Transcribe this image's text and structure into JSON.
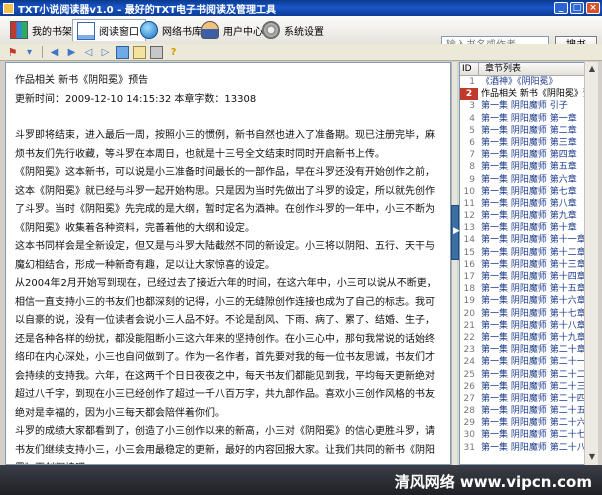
{
  "window": {
    "title": "TXT小说阅读器v1.0 - 最好的TXT电子书阅读及管理工具",
    "minimize": "_",
    "maximize": "□",
    "close": "×"
  },
  "nav": {
    "items": [
      {
        "label": "我的书架",
        "icon": "bookshelf-icon"
      },
      {
        "label": "阅读窗口",
        "icon": "reading-window-icon"
      },
      {
        "label": "网络书库",
        "icon": "globe-icon"
      },
      {
        "label": "用户中心",
        "icon": "user-icon"
      },
      {
        "label": "系统设置",
        "icon": "gear-icon"
      }
    ],
    "active": "阅读窗口"
  },
  "search": {
    "placeholder": "输入书名或作者",
    "button_label": "搜书"
  },
  "toolbar": {
    "icons": [
      "flag-icon",
      "dropdown-icon",
      "back-icon",
      "forward-icon",
      "prev-page-icon",
      "next-page-icon",
      "bookmark-icon",
      "view-icon",
      "settings-icon",
      "help-icon"
    ]
  },
  "document": {
    "title": "作品相关 新书《阴阳冕》预告",
    "meta": "更新时间：2009-12-10 14:15:32  本章字数：13308",
    "paragraphs": [
      "斗罗即将结束，进入最后一周，按照小三的惯例，新书自然也进入了准备期。现已注册完毕，麻烦书友们先行收藏，等斗罗在本周日，也就是十三号全文结束时同时开启新书上传。",
      "《阴阳冕》这本新书，可以说是小三准备时间最长的一部作品，早在斗罗还没有开始创作之前，这本《阴阳冕》就已经与斗罗一起开始构思。只是因为当时先做出了斗罗的设定，所以就先创作了斗罗。当时《阴阳冕》先完成的是大纲，暂时定名为酒神。在创作斗罗的一年中，小三不断为《阴阳冕》收集着各种资料，完善着他的大纲和设定。",
      "这本书同样会是全新设定，但又是与斗罗大陆截然不同的新设定。小三将以阴阳、五行、天干与魔幻相结合，形成一种新奇有趣，足以让大家惊喜的设定。",
      "从2004年2月开始写到现在，已经过去了接近六年的时间，在这六年中，小三可以说从不断更，相信一直支持小三的书友们也都深刻的记得，小三的无缝隙创作连接也成为了自己的标志。我可以自豪的说，没有一位读者会说小三人品不好。不论是刮风、下雨、病了、累了、结婚、生子，还是各种各样的纷扰，都没能阻断小三这六年来的坚持创作。在小三心中，那句我常说的话始终络印在内心深处，小三也自问做到了。作为一名作者，首先要对我的每一位书友思诚，书友们才会持续的支持我。六年，在这两千个日日夜夜之中，每天书友们都能见到我，平均每天更新绝对超过八千字，到现在小三已经创作了超过一千八百万字，共九部作品。喜欢小三创作风格的书友绝对是幸福的，因为小三每天都会陪伴着你们。",
      "斗罗的成绩大家都看到了，创造了小三创作以来的新高，小三对《阴阳冕》的信心更胜斗罗，请书友们继续支持小三，小三会用最稳定的更新，最好的内容回报大家。让我们共同的新书《阴阳冕》再创辉煌吧。"
    ]
  },
  "chapters": {
    "col_id": "ID",
    "col_title": "章节列表",
    "items": [
      {
        "id": "1",
        "title": "《酒神》《阴阳冕》"
      },
      {
        "id": "2",
        "title": "作品相关 新书《阴阳冕》预告"
      },
      {
        "id": "3",
        "title": "第一集 阴阳魔师 引子"
      },
      {
        "id": "4",
        "title": "第一集 阴阳魔师 第一章"
      },
      {
        "id": "5",
        "title": "第一集 阴阳魔师 第二章"
      },
      {
        "id": "6",
        "title": "第一集 阴阳魔师 第三章"
      },
      {
        "id": "7",
        "title": "第一集 阴阳魔师 第四章"
      },
      {
        "id": "8",
        "title": "第一集 阴阳魔师 第五章"
      },
      {
        "id": "9",
        "title": "第一集 阴阳魔师 第六章"
      },
      {
        "id": "10",
        "title": "第一集 阴阳魔师 第七章"
      },
      {
        "id": "11",
        "title": "第一集 阴阳魔师 第八章"
      },
      {
        "id": "12",
        "title": "第一集 阴阳魔师 第九章"
      },
      {
        "id": "13",
        "title": "第一集 阴阳魔师 第十章"
      },
      {
        "id": "14",
        "title": "第一集 阴阳魔师 第十一章"
      },
      {
        "id": "15",
        "title": "第一集 阴阳魔师 第十二章"
      },
      {
        "id": "16",
        "title": "第一集 阴阳魔师 第十三章"
      },
      {
        "id": "17",
        "title": "第一集 阴阳魔师 第十四章"
      },
      {
        "id": "18",
        "title": "第一集 阴阳魔师 第十五章"
      },
      {
        "id": "19",
        "title": "第一集 阴阳魔师 第十六章"
      },
      {
        "id": "20",
        "title": "第一集 阴阳魔师 第十七章"
      },
      {
        "id": "21",
        "title": "第一集 阴阳魔师 第十八章"
      },
      {
        "id": "22",
        "title": "第一集 阴阳魔师 第十九章"
      },
      {
        "id": "23",
        "title": "第一集 阴阳魔师 第二十章"
      },
      {
        "id": "24",
        "title": "第一集 阴阳魔师 第二十一章"
      },
      {
        "id": "25",
        "title": "第一集 阴阳魔师 第二十二章"
      },
      {
        "id": "26",
        "title": "第一集 阴阳魔师 第二十三章"
      },
      {
        "id": "27",
        "title": "第一集 阴阳魔师 第二十四章"
      },
      {
        "id": "28",
        "title": "第一集 阴阳魔师 第二十五章"
      },
      {
        "id": "29",
        "title": "第一集 阴阳魔师 第二十六章"
      },
      {
        "id": "30",
        "title": "第一集 阴阳魔师 第二十七章"
      },
      {
        "id": "31",
        "title": "第一集 阴阳魔师 第二十八章"
      }
    ],
    "selected_id": "2"
  },
  "watermark": "清风网络 www.vipcn.com"
}
